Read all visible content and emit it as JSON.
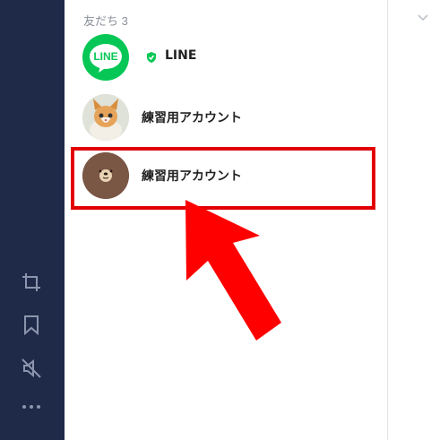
{
  "section": {
    "header": "友だち 3"
  },
  "friends": [
    {
      "name": "LINE",
      "avatar": "line-logo",
      "verified": true
    },
    {
      "name": "練習用アカウント",
      "avatar": "kitten-photo",
      "verified": false
    },
    {
      "name": "練習用アカウント",
      "avatar": "bear-face",
      "verified": false
    }
  ],
  "avatar_logo_text": "LINE",
  "sidebar": {
    "icons": [
      "crop-icon",
      "bookmark-icon",
      "mute-icon",
      "more-icon"
    ]
  },
  "colors": {
    "sidebar_bg": "#1f2a48",
    "line_green": "#06c755",
    "highlight": "#e20000",
    "arrow": "#ff0000"
  }
}
